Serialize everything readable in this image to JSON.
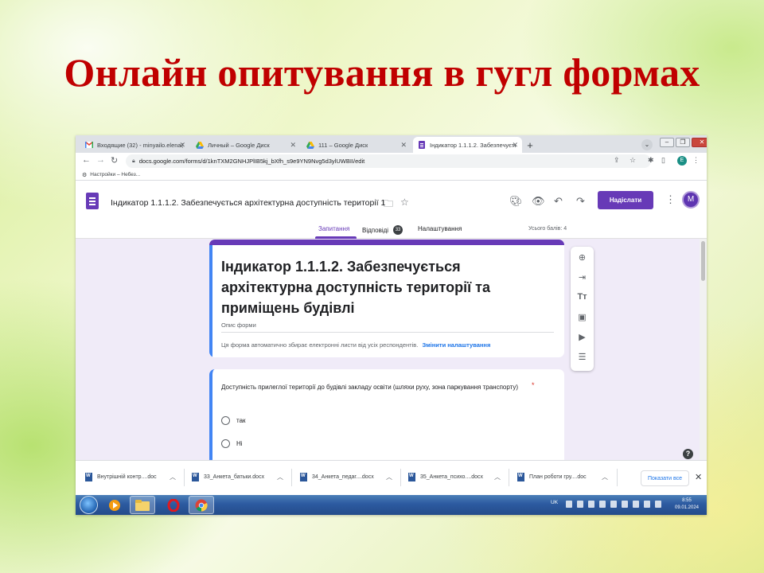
{
  "slide": {
    "title": "Онлайн опитування в гугл формах"
  },
  "browser": {
    "tabs": [
      {
        "label": "Входящие (32) - minyailo.elena@",
        "icon": "gmail-icon"
      },
      {
        "label": "Личный – Google Диск",
        "icon": "google-drive-icon"
      },
      {
        "label": "111 – Google Диск",
        "icon": "google-drive-icon"
      },
      {
        "label": "Індикатор 1.1.1.2. Забезпечуєтьс",
        "icon": "google-forms-icon",
        "active": true
      }
    ],
    "new_tab": "+",
    "url": "docs.google.com/forms/d/1knTXM2GNHJPlIB5kj_bXfh_s9e9YN9Nvg5d3ylUWBII/edit",
    "profile_initial": "E",
    "bookmark": "Настройки – Небез..."
  },
  "forms": {
    "doc_title": "Індикатор 1.1.1.2. Забезпечується архітектурна доступність території 1",
    "send_label": "Надіслати",
    "avatar_initial": "M",
    "tabs": {
      "questions": "Запитання",
      "responses": "Відповіді",
      "responses_count": "33",
      "settings": "Налаштування"
    },
    "total_points": "Усього балів: 4",
    "form_title": "Індикатор 1.1.1.2. Забезпечується архітектурна доступність території та приміщень будівлі",
    "form_description_placeholder": "Опис форми",
    "email_note": "Ця форма автоматично збирає електронні листи від усіх респондентів.",
    "change_settings": "Змінити налаштування",
    "question": {
      "text": "Доступність прилеглої території до будівлі закладу освіти (шляхи руху, зона паркування транспорту)",
      "required_mark": "*",
      "options": [
        "так",
        "Ні"
      ]
    },
    "help": "?"
  },
  "downloads": {
    "items": [
      "Внутрішній контр....doc",
      "33_Анкета_батьки.docx",
      "34_Анкета_педаг....docx",
      "35_Анкета_психо....docx",
      "План роботи гру....doc"
    ],
    "show_all": "Показати все"
  },
  "taskbar": {
    "language": "UK",
    "time": "8:55",
    "date": "09.01.2024"
  }
}
